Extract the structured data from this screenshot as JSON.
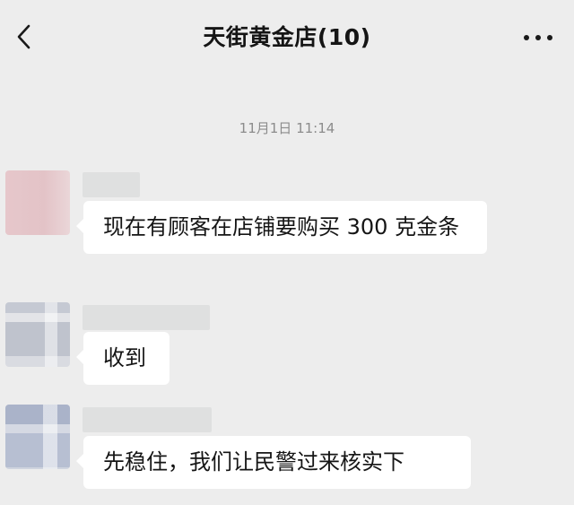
{
  "header": {
    "title": "天街黄金店(10)",
    "back_icon": "chevron-left-icon",
    "more_icon": "more-dots-icon"
  },
  "chat": {
    "timestamp": "11月1日 11:14",
    "messages": [
      {
        "text": "现在有顾客在店铺要购买 300 克金条"
      },
      {
        "text": "收到"
      },
      {
        "text": "先稳住，我们让民警过来核实下"
      }
    ]
  },
  "colors": {
    "background": "#ededed",
    "bubble": "#ffffff",
    "timestamp_text": "#8c8c8c"
  }
}
